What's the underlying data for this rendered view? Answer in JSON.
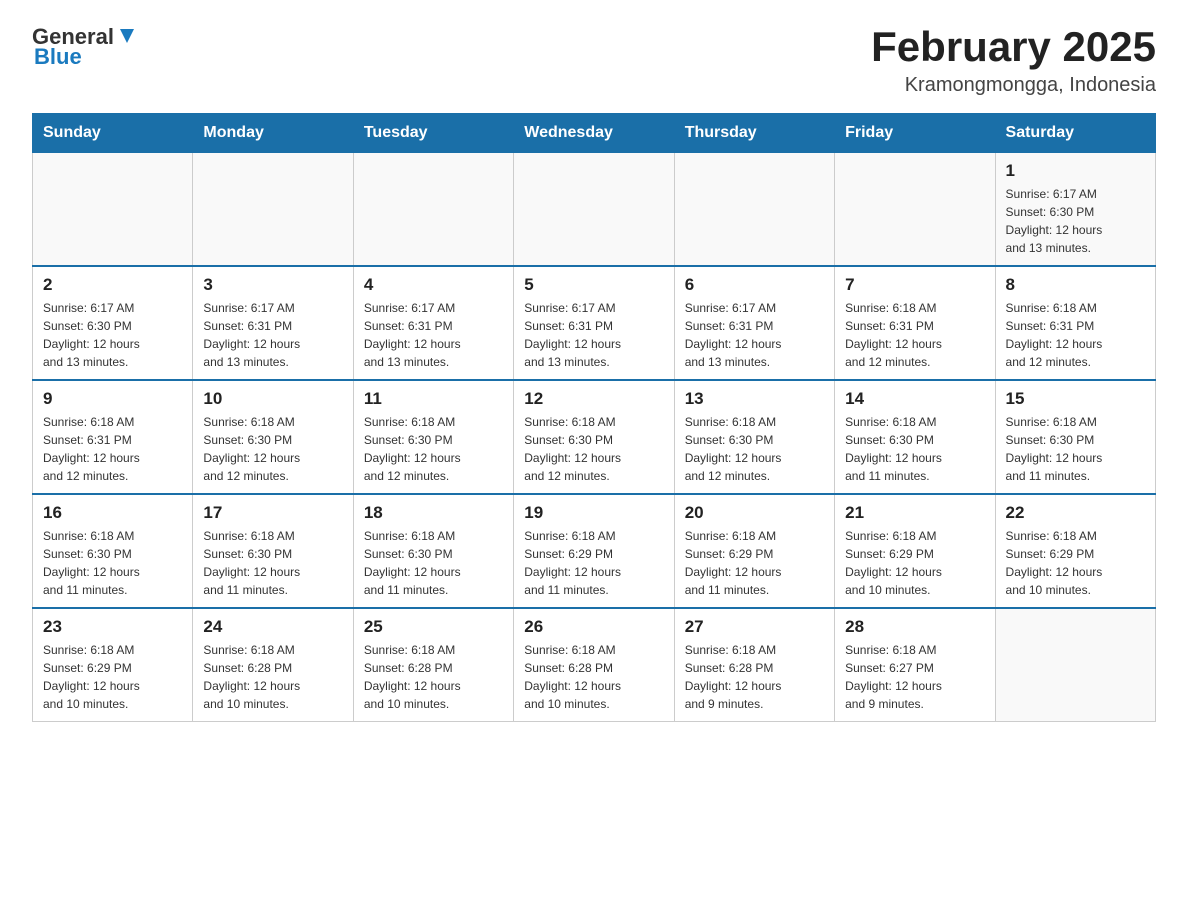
{
  "header": {
    "logo_general": "General",
    "logo_blue": "Blue",
    "title": "February 2025",
    "subtitle": "Kramongmongga, Indonesia"
  },
  "weekdays": [
    "Sunday",
    "Monday",
    "Tuesday",
    "Wednesday",
    "Thursday",
    "Friday",
    "Saturday"
  ],
  "weeks": [
    [
      {
        "day": "",
        "info": ""
      },
      {
        "day": "",
        "info": ""
      },
      {
        "day": "",
        "info": ""
      },
      {
        "day": "",
        "info": ""
      },
      {
        "day": "",
        "info": ""
      },
      {
        "day": "",
        "info": ""
      },
      {
        "day": "1",
        "info": "Sunrise: 6:17 AM\nSunset: 6:30 PM\nDaylight: 12 hours\nand 13 minutes."
      }
    ],
    [
      {
        "day": "2",
        "info": "Sunrise: 6:17 AM\nSunset: 6:30 PM\nDaylight: 12 hours\nand 13 minutes."
      },
      {
        "day": "3",
        "info": "Sunrise: 6:17 AM\nSunset: 6:31 PM\nDaylight: 12 hours\nand 13 minutes."
      },
      {
        "day": "4",
        "info": "Sunrise: 6:17 AM\nSunset: 6:31 PM\nDaylight: 12 hours\nand 13 minutes."
      },
      {
        "day": "5",
        "info": "Sunrise: 6:17 AM\nSunset: 6:31 PM\nDaylight: 12 hours\nand 13 minutes."
      },
      {
        "day": "6",
        "info": "Sunrise: 6:17 AM\nSunset: 6:31 PM\nDaylight: 12 hours\nand 13 minutes."
      },
      {
        "day": "7",
        "info": "Sunrise: 6:18 AM\nSunset: 6:31 PM\nDaylight: 12 hours\nand 12 minutes."
      },
      {
        "day": "8",
        "info": "Sunrise: 6:18 AM\nSunset: 6:31 PM\nDaylight: 12 hours\nand 12 minutes."
      }
    ],
    [
      {
        "day": "9",
        "info": "Sunrise: 6:18 AM\nSunset: 6:31 PM\nDaylight: 12 hours\nand 12 minutes."
      },
      {
        "day": "10",
        "info": "Sunrise: 6:18 AM\nSunset: 6:30 PM\nDaylight: 12 hours\nand 12 minutes."
      },
      {
        "day": "11",
        "info": "Sunrise: 6:18 AM\nSunset: 6:30 PM\nDaylight: 12 hours\nand 12 minutes."
      },
      {
        "day": "12",
        "info": "Sunrise: 6:18 AM\nSunset: 6:30 PM\nDaylight: 12 hours\nand 12 minutes."
      },
      {
        "day": "13",
        "info": "Sunrise: 6:18 AM\nSunset: 6:30 PM\nDaylight: 12 hours\nand 12 minutes."
      },
      {
        "day": "14",
        "info": "Sunrise: 6:18 AM\nSunset: 6:30 PM\nDaylight: 12 hours\nand 11 minutes."
      },
      {
        "day": "15",
        "info": "Sunrise: 6:18 AM\nSunset: 6:30 PM\nDaylight: 12 hours\nand 11 minutes."
      }
    ],
    [
      {
        "day": "16",
        "info": "Sunrise: 6:18 AM\nSunset: 6:30 PM\nDaylight: 12 hours\nand 11 minutes."
      },
      {
        "day": "17",
        "info": "Sunrise: 6:18 AM\nSunset: 6:30 PM\nDaylight: 12 hours\nand 11 minutes."
      },
      {
        "day": "18",
        "info": "Sunrise: 6:18 AM\nSunset: 6:30 PM\nDaylight: 12 hours\nand 11 minutes."
      },
      {
        "day": "19",
        "info": "Sunrise: 6:18 AM\nSunset: 6:29 PM\nDaylight: 12 hours\nand 11 minutes."
      },
      {
        "day": "20",
        "info": "Sunrise: 6:18 AM\nSunset: 6:29 PM\nDaylight: 12 hours\nand 11 minutes."
      },
      {
        "day": "21",
        "info": "Sunrise: 6:18 AM\nSunset: 6:29 PM\nDaylight: 12 hours\nand 10 minutes."
      },
      {
        "day": "22",
        "info": "Sunrise: 6:18 AM\nSunset: 6:29 PM\nDaylight: 12 hours\nand 10 minutes."
      }
    ],
    [
      {
        "day": "23",
        "info": "Sunrise: 6:18 AM\nSunset: 6:29 PM\nDaylight: 12 hours\nand 10 minutes."
      },
      {
        "day": "24",
        "info": "Sunrise: 6:18 AM\nSunset: 6:28 PM\nDaylight: 12 hours\nand 10 minutes."
      },
      {
        "day": "25",
        "info": "Sunrise: 6:18 AM\nSunset: 6:28 PM\nDaylight: 12 hours\nand 10 minutes."
      },
      {
        "day": "26",
        "info": "Sunrise: 6:18 AM\nSunset: 6:28 PM\nDaylight: 12 hours\nand 10 minutes."
      },
      {
        "day": "27",
        "info": "Sunrise: 6:18 AM\nSunset: 6:28 PM\nDaylight: 12 hours\nand 9 minutes."
      },
      {
        "day": "28",
        "info": "Sunrise: 6:18 AM\nSunset: 6:27 PM\nDaylight: 12 hours\nand 9 minutes."
      },
      {
        "day": "",
        "info": ""
      }
    ]
  ]
}
